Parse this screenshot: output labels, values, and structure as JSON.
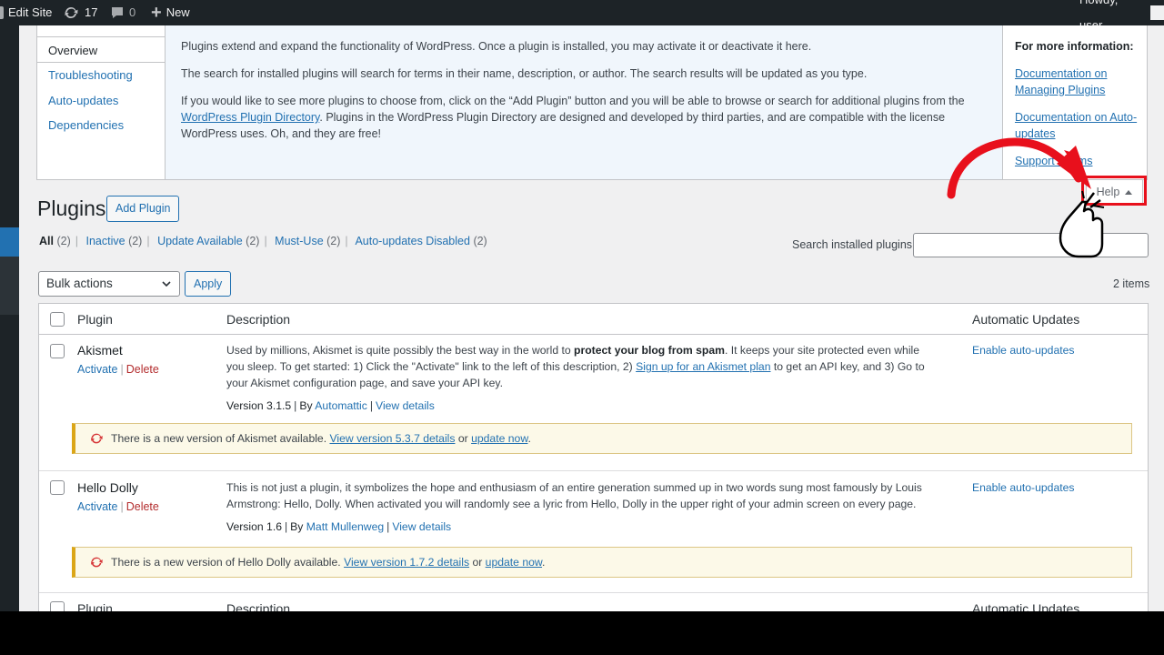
{
  "adminbar": {
    "edit_site": "Edit Site",
    "updates_count": "17",
    "comments_count": "0",
    "new_label": "New",
    "howdy": "Howdy, user"
  },
  "help": {
    "tabs": [
      "Overview",
      "Troubleshooting",
      "Auto-updates",
      "Dependencies"
    ],
    "p1": "Plugins extend and expand the functionality of WordPress. Once a plugin is installed, you may activate it or deactivate it here.",
    "p2": "The search for installed plugins will search for terms in their name, description, or author. The search results will be updated as you type.",
    "p3_a": "If you would like to see more plugins to choose from, click on the “Add Plugin” button and you will be able to browse or search for additional plugins from the ",
    "p3_link": "WordPress Plugin Directory",
    "p3_b": ". Plugins in the WordPress Plugin Directory are designed and developed by third parties, and are compatible with the license WordPress uses. Oh, and they are free!",
    "side_heading": "For more information:",
    "side_links": [
      "Documentation on Managing Plugins",
      "Documentation on Auto-updates",
      "Support forums"
    ],
    "button_label": "Help"
  },
  "page": {
    "title": "Plugins",
    "add_plugin": "Add Plugin"
  },
  "filters": [
    {
      "label": "All",
      "count": "(2)"
    },
    {
      "label": "Inactive",
      "count": "(2)"
    },
    {
      "label": "Update Available",
      "count": "(2)"
    },
    {
      "label": "Must-Use",
      "count": "(2)"
    },
    {
      "label": "Auto-updates Disabled",
      "count": "(2)"
    }
  ],
  "search": {
    "label": "Search installed plugins",
    "value": ""
  },
  "bulk": {
    "selected": "Bulk actions",
    "apply": "Apply",
    "items_count": "2 items"
  },
  "table": {
    "headers": [
      "Plugin",
      "Description",
      "Automatic Updates"
    ]
  },
  "plugins": [
    {
      "name": "Akismet",
      "activate": "Activate",
      "delete": "Delete",
      "desc_a": "Used by millions, Akismet is quite possibly the best way in the world to ",
      "desc_bold": "protect your blog from spam",
      "desc_b": ". It keeps your site protected even while you sleep. To get started: 1) Click the \"Activate\" link to the left of this description, 2) ",
      "desc_link": "Sign up for an Akismet plan",
      "desc_c": " to get an API key, and 3) Go to your Akismet configuration page, and save your API key.",
      "version": "Version 3.1.5",
      "by": "By",
      "author": "Automattic",
      "view_details": "View details",
      "auto_updates": "Enable auto-updates",
      "notice_text": "There is a new version of Akismet available.",
      "notice_link": "View version 5.3.7 details",
      "notice_or": "or",
      "notice_update": "update now",
      "notice_end": "."
    },
    {
      "name": "Hello Dolly",
      "activate": "Activate",
      "delete": "Delete",
      "desc_a": "This is not just a plugin, it symbolizes the hope and enthusiasm of an entire generation summed up in two words sung most famously by Louis Armstrong: Hello, Dolly. When activated you will randomly see a lyric from Hello, Dolly in the upper right of your admin screen on every page.",
      "version": "Version 1.6",
      "by": "By",
      "author": "Matt Mullenweg",
      "view_details": "View details",
      "auto_updates": "Enable auto-updates",
      "notice_text": "There is a new version of Hello Dolly available.",
      "notice_link": "View version 1.7.2 details",
      "notice_or": "or",
      "notice_update": "update now",
      "notice_end": "."
    }
  ],
  "colors": {
    "admin_bar": "#1d2327",
    "link": "#2271b1",
    "delete": "#b32d2e",
    "notice_border": "#dba617",
    "highlight": "#e8101c"
  }
}
